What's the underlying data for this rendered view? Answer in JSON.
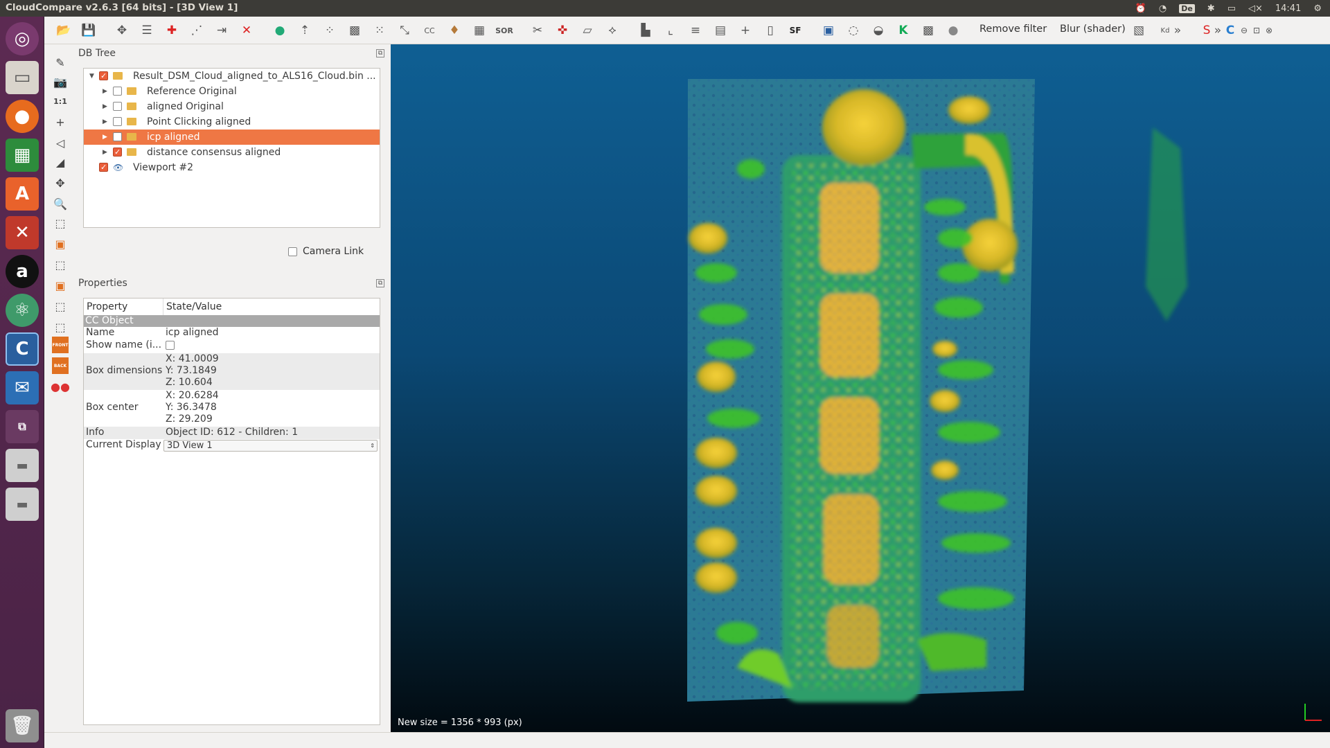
{
  "window": {
    "title": "CloudCompare v2.6.3 [64 bits] - [3D View 1]"
  },
  "tray": {
    "keyboard": "De",
    "time": "14:41"
  },
  "launcher": {
    "icons": [
      "ubuntu-dash-icon",
      "files-icon",
      "firefox-icon",
      "spreadsheet-icon",
      "software-center-icon",
      "settings-icon",
      "amazon-icon",
      "atom-icon",
      "cloudcompare-icon",
      "thunderbird-icon",
      "workspace-switcher-icon",
      "drive-icon",
      "drive-icon",
      "trash-icon"
    ]
  },
  "toolbar": {
    "remove_filter": "Remove filter",
    "blur_shader": "Blur (shader)",
    "sf_label": "SF",
    "sor_label": "SOR",
    "cc_label": "CC",
    "more": "»"
  },
  "lefttools": {
    "one_to_one": "1:1",
    "front_label": "FRONT",
    "back_label": "BACK"
  },
  "dbtree": {
    "title": "DB Tree",
    "items": [
      {
        "label": "Result_DSM_Cloud_aligned_to_ALS16_Cloud.bin ...",
        "checked": true
      },
      {
        "label": "Reference Original",
        "checked": false
      },
      {
        "label": "aligned Original",
        "checked": false
      },
      {
        "label": "Point Clicking aligned",
        "checked": false
      },
      {
        "label": "icp aligned",
        "checked": false
      },
      {
        "label": "distance consensus aligned",
        "checked": true
      },
      {
        "label": "Viewport #2",
        "checked": true
      }
    ]
  },
  "camera_link": "Camera Link",
  "properties": {
    "title": "Properties",
    "header": {
      "property": "Property",
      "value": "State/Value"
    },
    "section": "CC Object",
    "name_key": "Name",
    "name_val": "icp aligned",
    "show_name_key": "Show name (i...",
    "box_dim_key": "Box dimensions",
    "box_dim": {
      "x": "X: 41.0009",
      "y": "Y: 73.1849",
      "z": "Z: 10.604"
    },
    "box_center_key": "Box center",
    "box_center": {
      "x": "X: 20.6284",
      "y": "Y: 36.3478",
      "z": "Z: 29.209"
    },
    "info_key": "Info",
    "info_val": "Object ID: 612 - Children: 1",
    "display_key": "Current Display",
    "display_val": "3D View 1"
  },
  "view": {
    "status": "New size = 1356 * 993 (px)"
  }
}
